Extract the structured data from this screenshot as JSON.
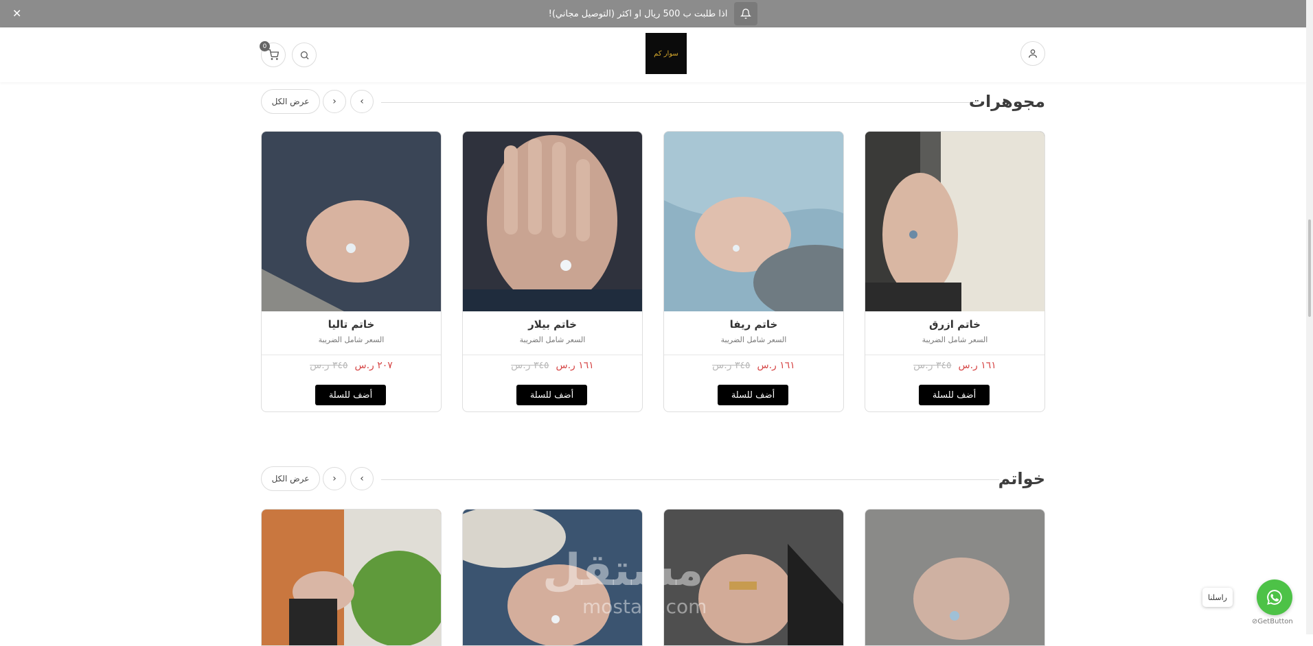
{
  "announcement": {
    "text": "اذا طلبت ب 500 ريال او اكثر (التوصيل مجاني)!",
    "close": "✕"
  },
  "header": {
    "logo_text": "سوار كم",
    "cart_count": "0"
  },
  "sections": [
    {
      "title": "مجوهرات",
      "view_all": "عرض الكل",
      "products": [
        {
          "name": "خاتم ازرق",
          "tax_note": "السعر شامل الضريبة",
          "price": "١٦١ ر.س",
          "old_price": "٣٤٥ ر.س",
          "add_label": "أضف للسلة"
        },
        {
          "name": "خاتم ريفا",
          "tax_note": "السعر شامل الضريبة",
          "price": "١٦١ ر.س",
          "old_price": "٣٤٥ ر.س",
          "add_label": "أضف للسلة"
        },
        {
          "name": "خاتم بيلار",
          "tax_note": "السعر شامل الضريبة",
          "price": "١٦١ ر.س",
          "old_price": "٣٤٥ ر.س",
          "add_label": "أضف للسلة"
        },
        {
          "name": "خاتم تاليا",
          "tax_note": "السعر شامل الضريبة",
          "price": "٢٠٧ ر.س",
          "old_price": "٣٤٥ ر.س",
          "add_label": "أضف للسلة"
        }
      ]
    },
    {
      "title": "خواتم",
      "view_all": "عرض الكل"
    }
  ],
  "whatsapp": {
    "label": "راسلنا",
    "brand": "GetButton"
  },
  "watermark": {
    "arabic": "مستقل",
    "latin": "mostaql.com"
  }
}
